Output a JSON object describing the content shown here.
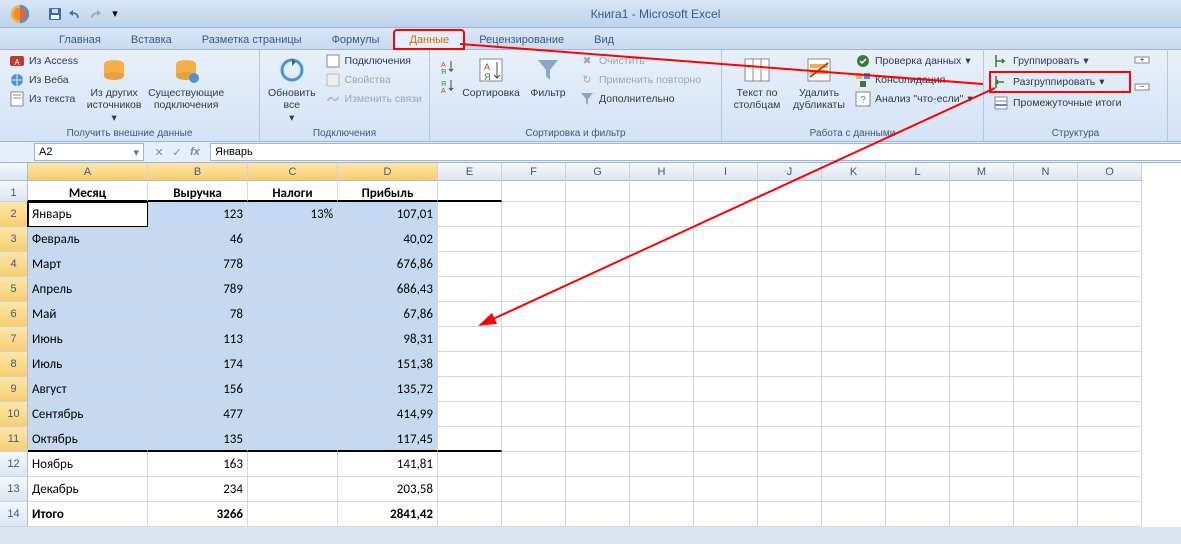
{
  "title": "Книга1 - Microsoft Excel",
  "tabs": [
    "Главная",
    "Вставка",
    "Разметка страницы",
    "Формулы",
    "Данные",
    "Рецензирование",
    "Вид"
  ],
  "active_tab": "Данные",
  "ribbon": {
    "g1": {
      "label": "Получить внешние данные",
      "access": "Из Access",
      "web": "Из Веба",
      "text": "Из текста",
      "other": "Из других источников",
      "existing": "Существующие подключения"
    },
    "g2": {
      "label": "Подключения",
      "refresh": "Обновить все",
      "conn": "Подключения",
      "props": "Свойства",
      "links": "Изменить связи"
    },
    "g3": {
      "label": "Сортировка и фильтр",
      "sort": "Сортировка",
      "filter": "Фильтр",
      "clear": "Очистить",
      "reapply": "Применить повторно",
      "advanced": "Дополнительно"
    },
    "g4": {
      "label": "Работа с данными",
      "text_cols": "Текст по столбцам",
      "dedup": "Удалить дубликаты",
      "valid": "Проверка данных",
      "consol": "Консолидация",
      "whatif": "Анализ \"что-если\""
    },
    "g5": {
      "label": "Структура",
      "group": "Группировать",
      "ungroup": "Разгруппировать",
      "subtotal": "Промежуточные итоги"
    }
  },
  "namebox": "A2",
  "formula": "Январь",
  "columns": [
    "A",
    "B",
    "C",
    "D",
    "E",
    "F",
    "G",
    "H",
    "I",
    "J",
    "K",
    "L",
    "M",
    "N",
    "O"
  ],
  "headers": {
    "A": "Месяц",
    "B": "Выручка",
    "C": "Налоги",
    "D": "Прибыль"
  },
  "rows": [
    {
      "n": 2,
      "A": "Январь",
      "B": "123",
      "C": "13%",
      "D": "107,01",
      "sel": true,
      "active": true
    },
    {
      "n": 3,
      "A": "Февраль",
      "B": "46",
      "C": "",
      "D": "40,02",
      "sel": true
    },
    {
      "n": 4,
      "A": "Март",
      "B": "778",
      "C": "",
      "D": "676,86",
      "sel": true
    },
    {
      "n": 5,
      "A": "Апрель",
      "B": "789",
      "C": "",
      "D": "686,43",
      "sel": true
    },
    {
      "n": 6,
      "A": "Май",
      "B": "78",
      "C": "",
      "D": "67,86",
      "sel": true
    },
    {
      "n": 7,
      "A": "Июнь",
      "B": "113",
      "C": "",
      "D": "98,31",
      "sel": true
    },
    {
      "n": 8,
      "A": "Июль",
      "B": "174",
      "C": "",
      "D": "151,38",
      "sel": true
    },
    {
      "n": 9,
      "A": "Август",
      "B": "156",
      "C": "",
      "D": "135,72",
      "sel": true
    },
    {
      "n": 10,
      "A": "Сентябрь",
      "B": "477",
      "C": "",
      "D": "414,99",
      "sel": true
    },
    {
      "n": 11,
      "A": "Октябрь",
      "B": "135",
      "C": "",
      "D": "117,45",
      "sel": true,
      "thick": true
    },
    {
      "n": 12,
      "A": "Ноябрь",
      "B": "163",
      "C": "",
      "D": "141,81"
    },
    {
      "n": 13,
      "A": "Декабрь",
      "B": "234",
      "C": "",
      "D": "203,58"
    },
    {
      "n": 14,
      "A": "Итого",
      "B": "3266",
      "C": "",
      "D": "2841,42",
      "bold": true
    }
  ]
}
